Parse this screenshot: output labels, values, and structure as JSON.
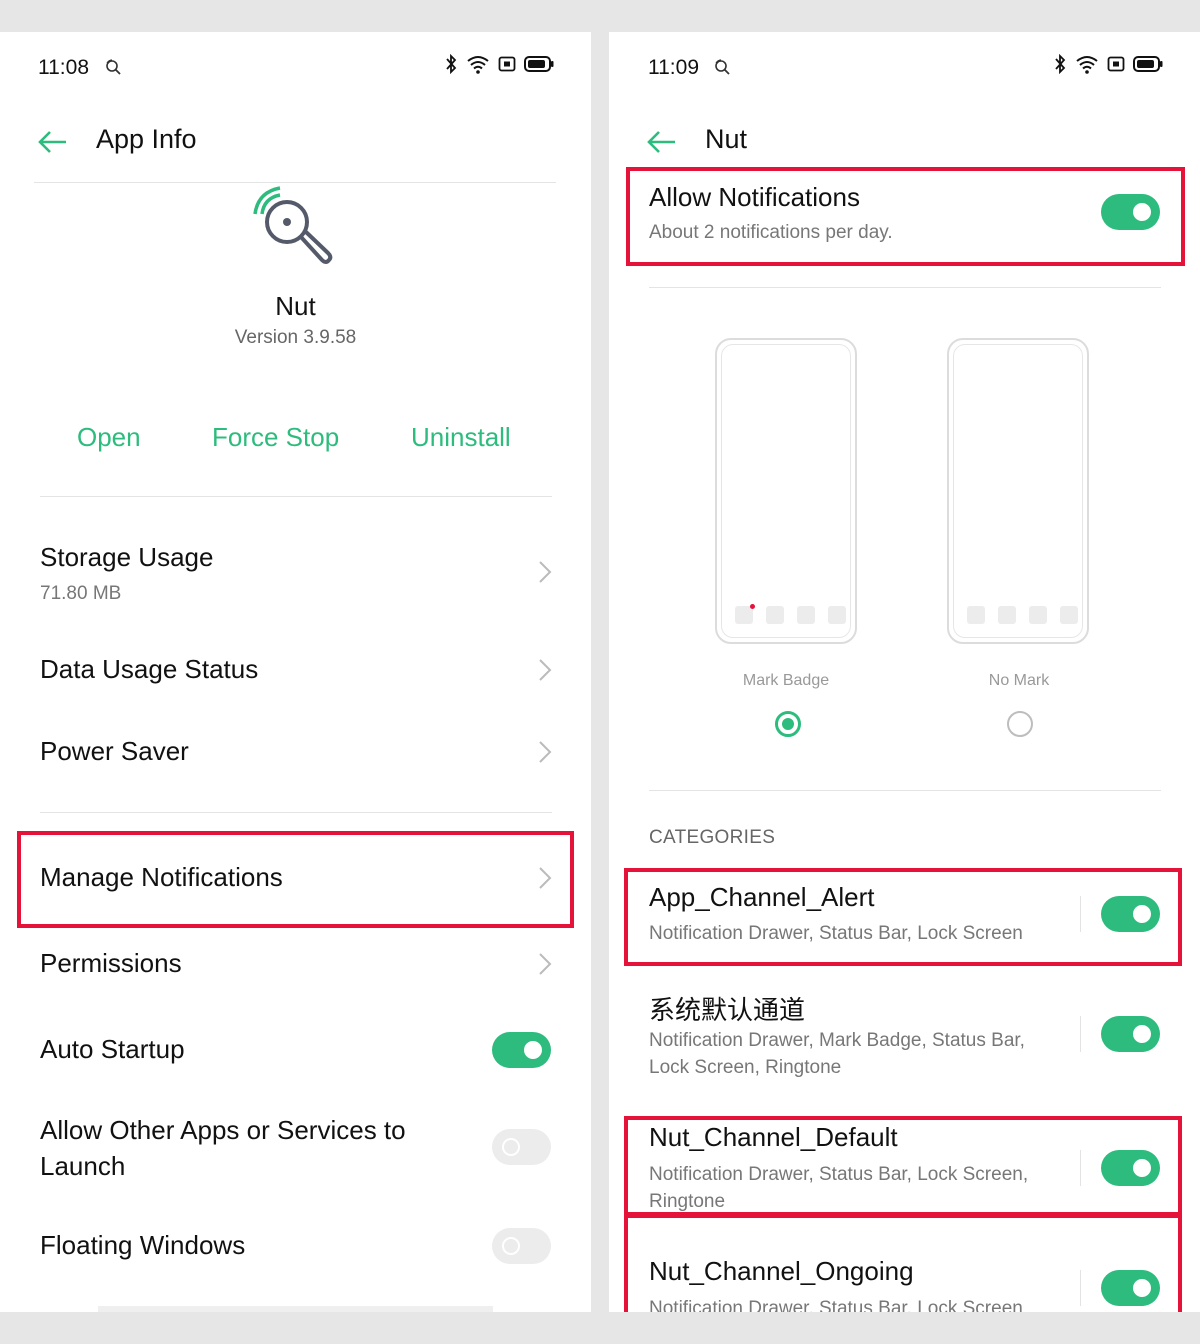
{
  "left": {
    "status_time": "11:08",
    "title": "App Info",
    "app_name": "Nut",
    "version": "Version 3.9.58",
    "actions": {
      "open": "Open",
      "force_stop": "Force Stop",
      "uninstall": "Uninstall"
    },
    "rows": {
      "storage_usage": {
        "title": "Storage Usage",
        "sub": "71.80 MB"
      },
      "data_usage": {
        "title": "Data Usage Status"
      },
      "power_saver": {
        "title": "Power Saver"
      },
      "manage_notifications": {
        "title": "Manage Notifications"
      },
      "permissions": {
        "title": "Permissions"
      },
      "auto_startup": {
        "title": "Auto Startup",
        "enabled": true
      },
      "allow_other_apps": {
        "title": "Allow Other Apps or Services to Launch",
        "enabled": false
      },
      "floating_windows": {
        "title": "Floating Windows",
        "enabled": false
      }
    }
  },
  "right": {
    "status_time": "11:09",
    "title": "Nut",
    "allow_notifications": {
      "title": "Allow Notifications",
      "sub": "About 2 notifications per day.",
      "enabled": true
    },
    "badge_options": {
      "mark_badge": {
        "label": "Mark Badge",
        "selected": true
      },
      "no_mark": {
        "label": "No Mark",
        "selected": false
      }
    },
    "categories_header": "CATEGORIES",
    "categories": [
      {
        "title": "App_Channel_Alert",
        "sub": "Notification Drawer, Status Bar, Lock Screen",
        "enabled": true
      },
      {
        "title": "系统默认通道",
        "sub": "Notification Drawer, Mark Badge, Status Bar, Lock Screen, Ringtone",
        "enabled": true
      },
      {
        "title": "Nut_Channel_Default",
        "sub": "Notification Drawer, Status Bar, Lock Screen, Ringtone",
        "enabled": true
      },
      {
        "title": "Nut_Channel_Ongoing",
        "sub": "Notification Drawer, Status Bar, Lock Screen",
        "enabled": true
      }
    ]
  },
  "colors": {
    "accent": "#2dbc7d",
    "highlight": "#e5133a"
  },
  "icons": [
    "bluetooth-icon",
    "wifi-icon",
    "nfc-icon",
    "battery-icon",
    "search-notification-icon",
    "back-arrow-icon",
    "chevron-right-icon"
  ]
}
